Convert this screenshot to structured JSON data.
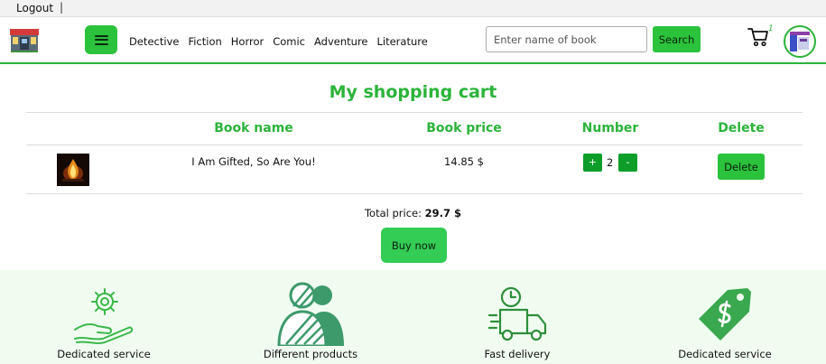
{
  "topbar": {
    "logout_label": "Logout",
    "separator": "|"
  },
  "header": {
    "nav": [
      "Detective",
      "Fiction",
      "Horror",
      "Comic",
      "Adventure",
      "Literature"
    ],
    "search_placeholder": "Enter name of book",
    "search_button": "Search",
    "cart_count": "1",
    "menu_icon": "hamburger-menu-icon",
    "cart_icon": "shopping-cart-icon"
  },
  "cart": {
    "title": "My shopping cart",
    "columns": {
      "name": "Book name",
      "price": "Book price",
      "number": "Number",
      "delete": "Delete"
    },
    "items": [
      {
        "name": "I Am Gifted, So Are You!",
        "price": "14.85 $",
        "quantity": "2",
        "plus": "+",
        "minus": "-",
        "delete_label": "Delete"
      }
    ],
    "total_label": "Total price:",
    "total_value": "29.7 $",
    "buy_label": "Buy now"
  },
  "features": [
    {
      "icon": "gear-hand-icon",
      "label": "Dedicated service"
    },
    {
      "icon": "people-icon",
      "label": "Different products"
    },
    {
      "icon": "delivery-truck-icon",
      "label": "Fast delivery"
    },
    {
      "icon": "dollar-tag-icon",
      "label": "Dedicated service"
    }
  ],
  "colors": {
    "accent": "#2bb33a",
    "button": "#2bc23c",
    "qty_button": "#0c9e29",
    "feature_bg": "#f1fcf1"
  }
}
